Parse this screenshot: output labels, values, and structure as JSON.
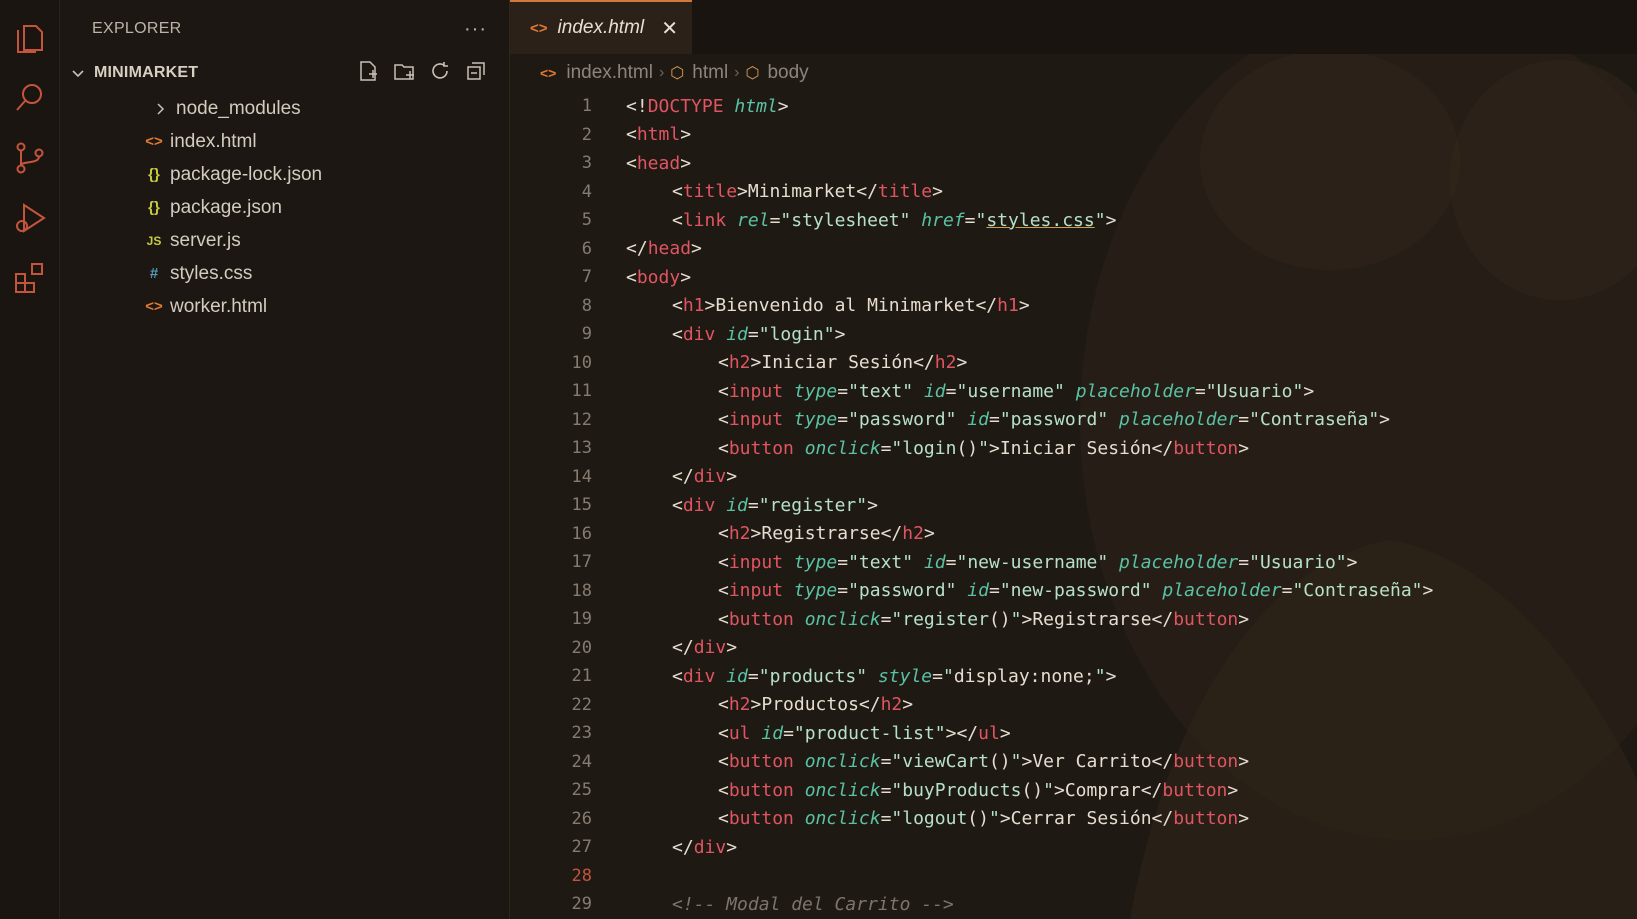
{
  "sidebar": {
    "title": "EXPLORER",
    "more": "···",
    "folder": "MINIMARKET",
    "items": [
      {
        "label": "node_modules",
        "icon": "chevron-right-icon",
        "type": "folder"
      },
      {
        "label": "index.html",
        "icon": "html-file-icon",
        "glyph": "<>",
        "type": "html"
      },
      {
        "label": "package-lock.json",
        "icon": "json-file-icon",
        "glyph": "{}",
        "type": "json"
      },
      {
        "label": "package.json",
        "icon": "json-file-icon",
        "glyph": "{}",
        "type": "json"
      },
      {
        "label": "server.js",
        "icon": "js-file-icon",
        "glyph": "JS",
        "type": "js"
      },
      {
        "label": "styles.css",
        "icon": "css-file-icon",
        "glyph": "#",
        "type": "css"
      },
      {
        "label": "worker.html",
        "icon": "html-file-icon",
        "glyph": "<>",
        "type": "html"
      }
    ]
  },
  "tab": {
    "label": "index.html",
    "glyph": "<>",
    "close": "✕"
  },
  "breadcrumb": {
    "file": "index.html",
    "crumb1": "html",
    "crumb2": "body",
    "sep": "›",
    "html_glyph": "<>",
    "box_glyph": "⬡"
  },
  "editor": {
    "current_line": 28,
    "lines": [
      {
        "n": "1",
        "indent": 0,
        "tokens": [
          [
            "p",
            "<!"
          ],
          [
            "kw",
            "DOCTYPE"
          ],
          [
            "p",
            " "
          ],
          [
            "dt",
            "html"
          ],
          [
            "p",
            ">"
          ]
        ]
      },
      {
        "n": "2",
        "indent": 0,
        "tokens": [
          [
            "p",
            "<"
          ],
          [
            "t",
            "html"
          ],
          [
            "p",
            ">"
          ]
        ]
      },
      {
        "n": "3",
        "indent": 0,
        "tokens": [
          [
            "p",
            "<"
          ],
          [
            "t",
            "head"
          ],
          [
            "p",
            ">"
          ]
        ]
      },
      {
        "n": "4",
        "indent": 1,
        "tokens": [
          [
            "p",
            "<"
          ],
          [
            "t",
            "title"
          ],
          [
            "p",
            ">Minimarket</"
          ],
          [
            "t",
            "title"
          ],
          [
            "p",
            ">"
          ]
        ]
      },
      {
        "n": "5",
        "indent": 1,
        "tokens": [
          [
            "p",
            "<"
          ],
          [
            "t",
            "link"
          ],
          [
            "p",
            " "
          ],
          [
            "a",
            "rel"
          ],
          [
            "p",
            "="
          ],
          [
            "s",
            "\"stylesheet\""
          ],
          [
            "p",
            " "
          ],
          [
            "a",
            "href"
          ],
          [
            "p",
            "="
          ],
          [
            "s",
            "\""
          ],
          [
            "s-u",
            "styles.css"
          ],
          [
            "s",
            "\""
          ],
          [
            "p",
            ">"
          ]
        ]
      },
      {
        "n": "6",
        "indent": 0,
        "tokens": [
          [
            "p",
            "</"
          ],
          [
            "t",
            "head"
          ],
          [
            "p",
            ">"
          ]
        ]
      },
      {
        "n": "7",
        "indent": 0,
        "tokens": [
          [
            "p",
            "<"
          ],
          [
            "t",
            "body"
          ],
          [
            "p",
            ">"
          ]
        ]
      },
      {
        "n": "8",
        "indent": 1,
        "tokens": [
          [
            "p",
            "<"
          ],
          [
            "t",
            "h1"
          ],
          [
            "p",
            ">Bienvenido al Minimarket</"
          ],
          [
            "t",
            "h1"
          ],
          [
            "p",
            ">"
          ]
        ]
      },
      {
        "n": "9",
        "indent": 1,
        "tokens": [
          [
            "p",
            "<"
          ],
          [
            "t",
            "div"
          ],
          [
            "p",
            " "
          ],
          [
            "a",
            "id"
          ],
          [
            "p",
            "="
          ],
          [
            "s",
            "\"login\""
          ],
          [
            "p",
            ">"
          ]
        ]
      },
      {
        "n": "10",
        "indent": 2,
        "tokens": [
          [
            "p",
            "<"
          ],
          [
            "t",
            "h2"
          ],
          [
            "p",
            ">Iniciar Sesión</"
          ],
          [
            "t",
            "h2"
          ],
          [
            "p",
            ">"
          ]
        ]
      },
      {
        "n": "11",
        "indent": 2,
        "tokens": [
          [
            "p",
            "<"
          ],
          [
            "t",
            "input"
          ],
          [
            "p",
            " "
          ],
          [
            "a",
            "type"
          ],
          [
            "p",
            "="
          ],
          [
            "s",
            "\"text\""
          ],
          [
            "p",
            " "
          ],
          [
            "a",
            "id"
          ],
          [
            "p",
            "="
          ],
          [
            "s",
            "\"username\""
          ],
          [
            "p",
            " "
          ],
          [
            "a",
            "placeholder"
          ],
          [
            "p",
            "="
          ],
          [
            "s",
            "\"Usuario\""
          ],
          [
            "p",
            ">"
          ]
        ]
      },
      {
        "n": "12",
        "indent": 2,
        "tokens": [
          [
            "p",
            "<"
          ],
          [
            "t",
            "input"
          ],
          [
            "p",
            " "
          ],
          [
            "a",
            "type"
          ],
          [
            "p",
            "="
          ],
          [
            "s",
            "\"password\""
          ],
          [
            "p",
            " "
          ],
          [
            "a",
            "id"
          ],
          [
            "p",
            "="
          ],
          [
            "s",
            "\"password\""
          ],
          [
            "p",
            " "
          ],
          [
            "a",
            "placeholder"
          ],
          [
            "p",
            "="
          ],
          [
            "s",
            "\"Contraseña\""
          ],
          [
            "p",
            ">"
          ]
        ]
      },
      {
        "n": "13",
        "indent": 2,
        "tokens": [
          [
            "p",
            "<"
          ],
          [
            "t",
            "button"
          ],
          [
            "p",
            " "
          ],
          [
            "a",
            "onclick"
          ],
          [
            "p",
            "="
          ],
          [
            "s",
            "\"login"
          ],
          [
            "p",
            "()"
          ],
          [
            "s",
            "\""
          ],
          [
            "p",
            ">Iniciar Sesión</"
          ],
          [
            "t",
            "button"
          ],
          [
            "p",
            ">"
          ]
        ]
      },
      {
        "n": "14",
        "indent": 1,
        "tokens": [
          [
            "p",
            "</"
          ],
          [
            "t",
            "div"
          ],
          [
            "p",
            ">"
          ]
        ]
      },
      {
        "n": "15",
        "indent": 1,
        "tokens": [
          [
            "p",
            "<"
          ],
          [
            "t",
            "div"
          ],
          [
            "p",
            " "
          ],
          [
            "a",
            "id"
          ],
          [
            "p",
            "="
          ],
          [
            "s",
            "\"register\""
          ],
          [
            "p",
            ">"
          ]
        ]
      },
      {
        "n": "16",
        "indent": 2,
        "tokens": [
          [
            "p",
            "<"
          ],
          [
            "t",
            "h2"
          ],
          [
            "p",
            ">Registrarse</"
          ],
          [
            "t",
            "h2"
          ],
          [
            "p",
            ">"
          ]
        ]
      },
      {
        "n": "17",
        "indent": 2,
        "tokens": [
          [
            "p",
            "<"
          ],
          [
            "t",
            "input"
          ],
          [
            "p",
            " "
          ],
          [
            "a",
            "type"
          ],
          [
            "p",
            "="
          ],
          [
            "s",
            "\"text\""
          ],
          [
            "p",
            " "
          ],
          [
            "a",
            "id"
          ],
          [
            "p",
            "="
          ],
          [
            "s",
            "\"new-username\""
          ],
          [
            "p",
            " "
          ],
          [
            "a",
            "placeholder"
          ],
          [
            "p",
            "="
          ],
          [
            "s",
            "\"Usuario\""
          ],
          [
            "p",
            ">"
          ]
        ]
      },
      {
        "n": "18",
        "indent": 2,
        "tokens": [
          [
            "p",
            "<"
          ],
          [
            "t",
            "input"
          ],
          [
            "p",
            " "
          ],
          [
            "a",
            "type"
          ],
          [
            "p",
            "="
          ],
          [
            "s",
            "\"password\""
          ],
          [
            "p",
            " "
          ],
          [
            "a",
            "id"
          ],
          [
            "p",
            "="
          ],
          [
            "s",
            "\"new-password\""
          ],
          [
            "p",
            " "
          ],
          [
            "a",
            "placeholder"
          ],
          [
            "p",
            "="
          ],
          [
            "s",
            "\"Contraseña\""
          ],
          [
            "p",
            ">"
          ]
        ]
      },
      {
        "n": "19",
        "indent": 2,
        "tokens": [
          [
            "p",
            "<"
          ],
          [
            "t",
            "button"
          ],
          [
            "p",
            " "
          ],
          [
            "a",
            "onclick"
          ],
          [
            "p",
            "="
          ],
          [
            "s",
            "\"register"
          ],
          [
            "p",
            "()"
          ],
          [
            "s",
            "\""
          ],
          [
            "p",
            ">Registrarse</"
          ],
          [
            "t",
            "button"
          ],
          [
            "p",
            ">"
          ]
        ]
      },
      {
        "n": "20",
        "indent": 1,
        "tokens": [
          [
            "p",
            "</"
          ],
          [
            "t",
            "div"
          ],
          [
            "p",
            ">"
          ]
        ]
      },
      {
        "n": "21",
        "indent": 1,
        "tokens": [
          [
            "p",
            "<"
          ],
          [
            "t",
            "div"
          ],
          [
            "p",
            " "
          ],
          [
            "a",
            "id"
          ],
          [
            "p",
            "="
          ],
          [
            "s",
            "\"products\""
          ],
          [
            "p",
            " "
          ],
          [
            "a",
            "style"
          ],
          [
            "p",
            "="
          ],
          [
            "s",
            "\""
          ],
          [
            "p",
            "display:none;"
          ],
          [
            "s",
            "\""
          ],
          [
            "p",
            ">"
          ]
        ]
      },
      {
        "n": "22",
        "indent": 2,
        "tokens": [
          [
            "p",
            "<"
          ],
          [
            "t",
            "h2"
          ],
          [
            "p",
            ">Productos</"
          ],
          [
            "t",
            "h2"
          ],
          [
            "p",
            ">"
          ]
        ]
      },
      {
        "n": "23",
        "indent": 2,
        "tokens": [
          [
            "p",
            "<"
          ],
          [
            "t",
            "ul"
          ],
          [
            "p",
            " "
          ],
          [
            "a",
            "id"
          ],
          [
            "p",
            "="
          ],
          [
            "s",
            "\"product-list\""
          ],
          [
            "p",
            "></"
          ],
          [
            "t",
            "ul"
          ],
          [
            "p",
            ">"
          ]
        ]
      },
      {
        "n": "24",
        "indent": 2,
        "tokens": [
          [
            "p",
            "<"
          ],
          [
            "t",
            "button"
          ],
          [
            "p",
            " "
          ],
          [
            "a",
            "onclick"
          ],
          [
            "p",
            "="
          ],
          [
            "s",
            "\"viewCart"
          ],
          [
            "p",
            "()"
          ],
          [
            "s",
            "\""
          ],
          [
            "p",
            ">Ver Carrito</"
          ],
          [
            "t",
            "button"
          ],
          [
            "p",
            ">"
          ]
        ]
      },
      {
        "n": "25",
        "indent": 2,
        "tokens": [
          [
            "p",
            "<"
          ],
          [
            "t",
            "button"
          ],
          [
            "p",
            " "
          ],
          [
            "a",
            "onclick"
          ],
          [
            "p",
            "="
          ],
          [
            "s",
            "\"buyProducts"
          ],
          [
            "p",
            "()"
          ],
          [
            "s",
            "\""
          ],
          [
            "p",
            ">Comprar</"
          ],
          [
            "t",
            "button"
          ],
          [
            "p",
            ">"
          ]
        ]
      },
      {
        "n": "26",
        "indent": 2,
        "tokens": [
          [
            "p",
            "<"
          ],
          [
            "t",
            "button"
          ],
          [
            "p",
            " "
          ],
          [
            "a",
            "onclick"
          ],
          [
            "p",
            "="
          ],
          [
            "s",
            "\"logout"
          ],
          [
            "p",
            "()"
          ],
          [
            "s",
            "\""
          ],
          [
            "p",
            ">Cerrar Sesión</"
          ],
          [
            "t",
            "button"
          ],
          [
            "p",
            ">"
          ]
        ]
      },
      {
        "n": "27",
        "indent": 1,
        "tokens": [
          [
            "p",
            "</"
          ],
          [
            "t",
            "div"
          ],
          [
            "p",
            ">"
          ]
        ]
      },
      {
        "n": "28",
        "indent": 0,
        "tokens": []
      },
      {
        "n": "29",
        "indent": 1,
        "tokens": [
          [
            "c",
            "<!-- Modal del Carrito -->"
          ]
        ]
      }
    ]
  },
  "colors": {
    "accent": "#d0783e",
    "html_icon": "#e37933",
    "json_icon": "#cbcb41",
    "css_icon": "#519aba"
  }
}
